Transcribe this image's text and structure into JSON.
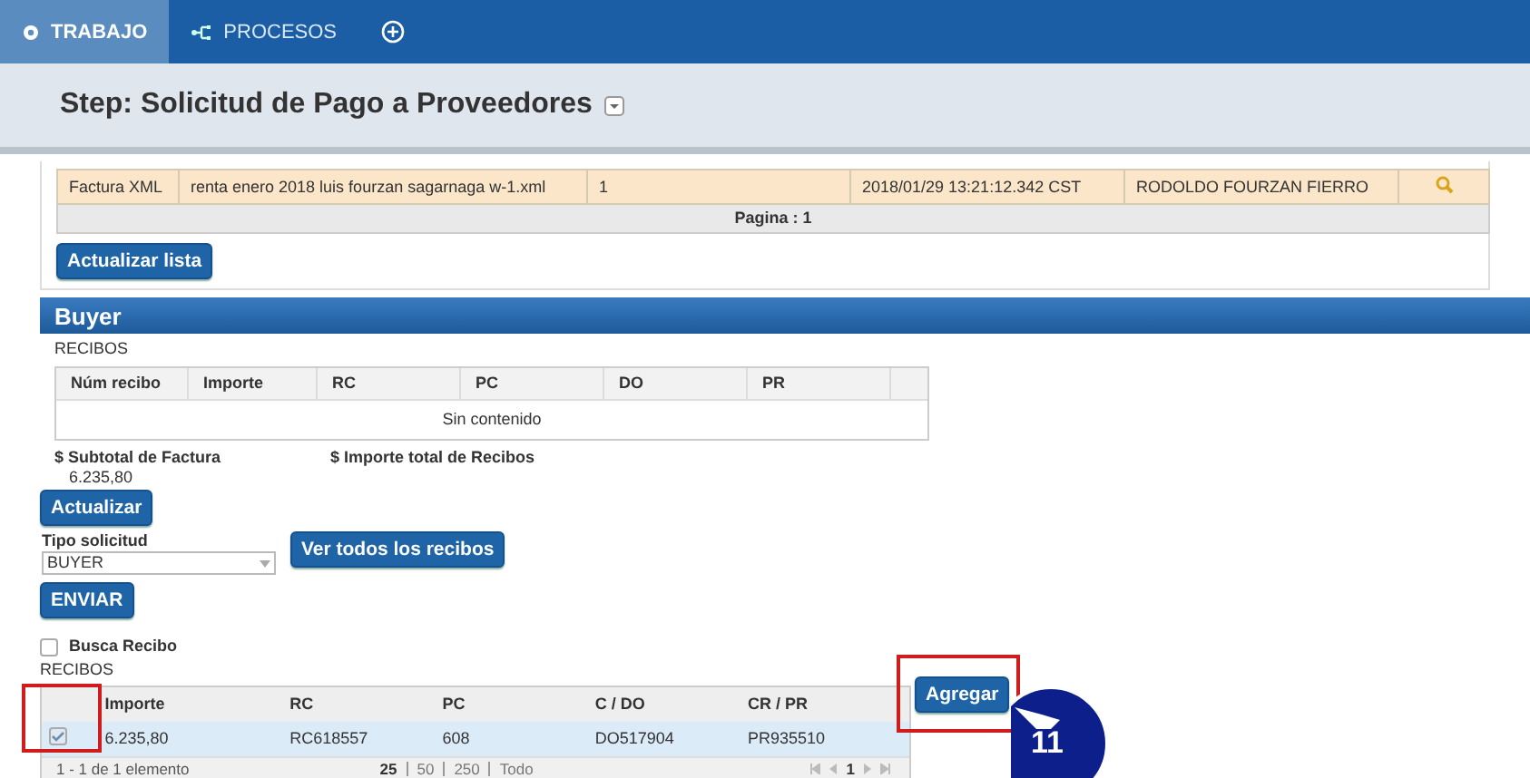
{
  "tabs": [
    {
      "label": "TRABAJO",
      "selected": true
    },
    {
      "label": "PROCESOS",
      "selected": false
    }
  ],
  "title": "Step: Solicitud de Pago a Proveedores",
  "documents": {
    "rows": [
      [
        "Factura XML",
        "renta enero 2018 luis fourzan sagarnaga w-1.xml",
        "1",
        "2018/01/29 13:21:12.342 CST",
        "RODOLDO FOURZAN FIERRO"
      ]
    ],
    "pager": "Pagina : 1",
    "refresh_button": "Actualizar lista"
  },
  "buyer": {
    "heading": "Buyer",
    "receipts_label": "RECIBOS",
    "columns": [
      "Núm recibo",
      "Importe",
      "RC",
      "PC",
      "DO",
      "PR"
    ],
    "empty": "Sin contenido",
    "subtotal_label": "$ Subtotal de Factura",
    "subtotal_value": "6.235,80",
    "total_label": "$ Importe total de Recibos",
    "update_button": "Actualizar",
    "request_type_label": "Tipo solicitud",
    "request_type_value": "BUYER",
    "view_all_button": "Ver todos los recibos",
    "send_button": "ENVIAR"
  },
  "search_receipt": {
    "label": "Busca Recibo",
    "checked": false
  },
  "receipts": {
    "label": "RECIBOS",
    "columns": [
      "Importe",
      "RC",
      "PC",
      "C / DO",
      "CR / PR"
    ],
    "rows": [
      {
        "selected": true,
        "checked": true,
        "cells": [
          "6.235,80",
          "RC618557",
          "608",
          "DO517904",
          "PR935510"
        ]
      }
    ],
    "summary": "1 - 1 de 1 elemento",
    "page_sizes": [
      {
        "label": "25",
        "selected": true
      },
      {
        "label": "50",
        "selected": false
      },
      {
        "label": "250",
        "selected": false
      },
      {
        "label": "Todo",
        "selected": false
      }
    ],
    "page": "1"
  },
  "add_button": "Agregar",
  "step_badge": "11"
}
